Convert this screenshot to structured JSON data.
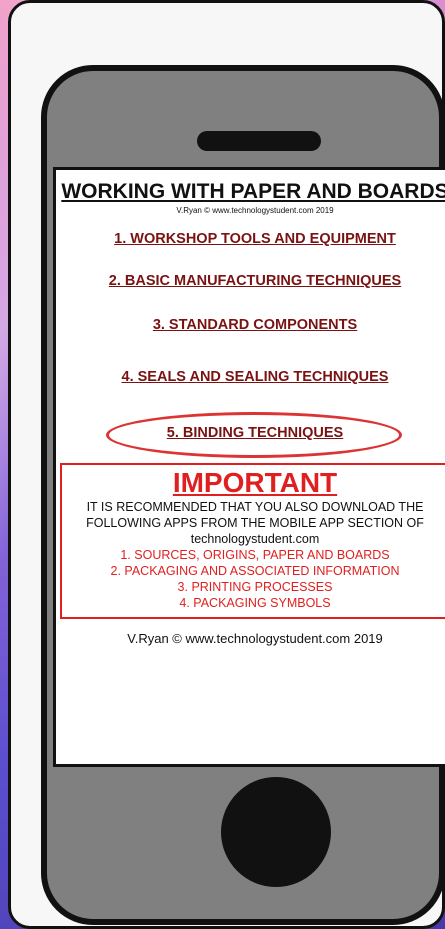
{
  "screen": {
    "title": "WORKING WITH PAPER AND BOARDS",
    "credit_small": "V.Ryan © www.technologystudent.com 2019",
    "menu": [
      {
        "label": "1. WORKSHOP TOOLS AND EQUIPMENT"
      },
      {
        "label": "2. BASIC MANUFACTURING TECHNIQUES"
      },
      {
        "label": "3. STANDARD COMPONENTS"
      },
      {
        "label": "4. SEALS AND SEALING TECHNIQUES"
      },
      {
        "label": "5. BINDING TECHNIQUES"
      }
    ],
    "important": {
      "heading": "IMPORTANT",
      "text": "IT IS RECOMMENDED THAT YOU ALSO DOWNLOAD THE FOLLOWING APPS FROM THE MOBILE APP SECTION OF technologystudent.com",
      "apps": [
        "1. SOURCES, ORIGINS, PAPER AND BOARDS",
        "2. PACKAGING AND ASSOCIATED INFORMATION",
        "3. PRINTING PROCESSES",
        "4. PACKAGING SYMBOLS"
      ]
    },
    "footer": "V.Ryan © www.technologystudent.com 2019"
  },
  "colors": {
    "link": "#7a1212",
    "highlight_oval": "#d33333",
    "important": "#e02020",
    "phone_body": "#808080"
  }
}
